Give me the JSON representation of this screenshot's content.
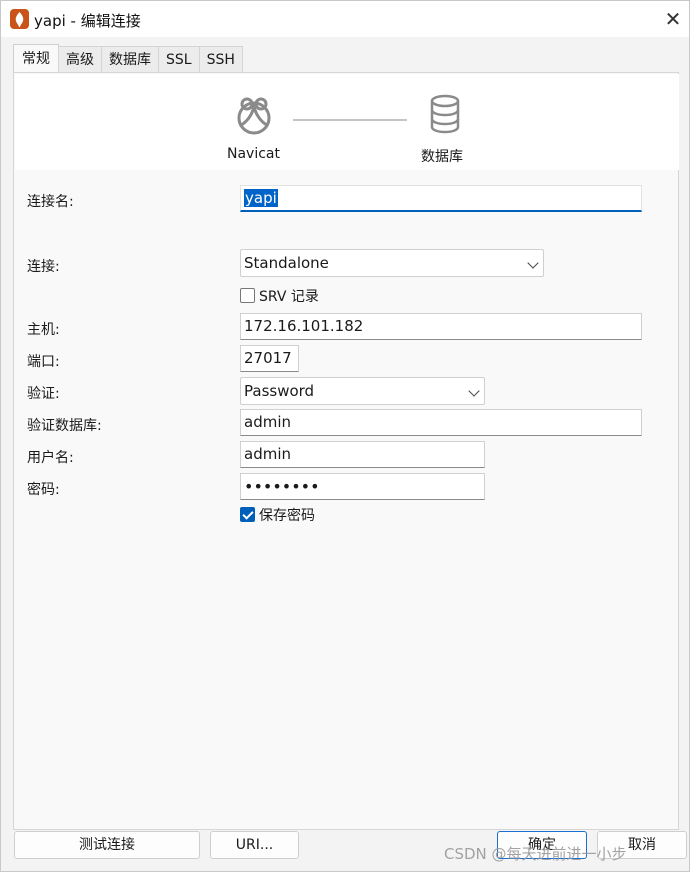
{
  "window": {
    "title": "yapi - 编辑连接",
    "close": "✕"
  },
  "tabs": [
    {
      "label": "常规"
    },
    {
      "label": "高级"
    },
    {
      "label": "数据库"
    },
    {
      "label": "SSL"
    },
    {
      "label": "SSH"
    }
  ],
  "banner": {
    "left_label": "Navicat",
    "right_label": "数据库"
  },
  "form": {
    "conn_name_label": "连接名:",
    "conn_name_value": "yapi",
    "connection_label": "连接:",
    "connection_value": "Standalone",
    "srv_label": "SRV 记录",
    "srv_checked": false,
    "host_label": "主机:",
    "host_value": "172.16.101.182",
    "port_label": "端口:",
    "port_value": "27017",
    "auth_label": "验证:",
    "auth_value": "Password",
    "auth_db_label": "验证数据库:",
    "auth_db_value": "admin",
    "user_label": "用户名:",
    "user_value": "admin",
    "password_label": "密码:",
    "password_value": "••••••••",
    "save_pwd_label": "保存密码",
    "save_pwd_checked": true
  },
  "buttons": {
    "test": "测试连接",
    "uri": "URI...",
    "ok": "确定",
    "cancel": "取消"
  },
  "watermark": "CSDN @每天进前进一小步",
  "colors": {
    "accent": "#005fb8",
    "app_icon": "#c8541a"
  }
}
